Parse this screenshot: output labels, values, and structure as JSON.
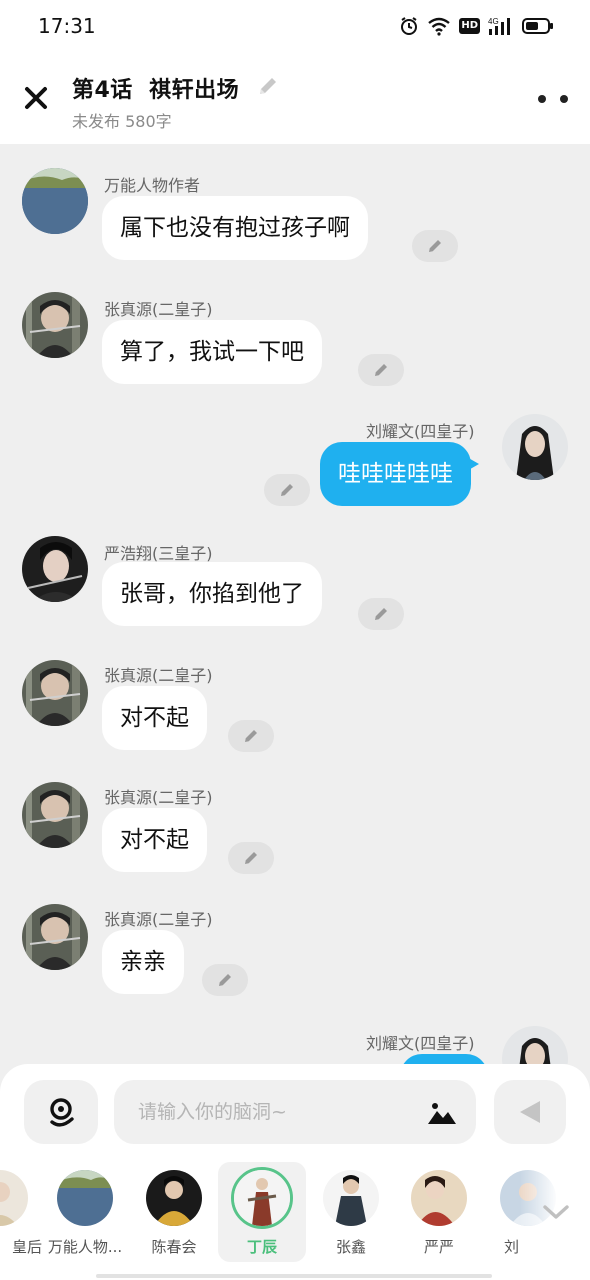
{
  "status": {
    "time": "17:31",
    "network": "4G",
    "hd": "HD"
  },
  "header": {
    "title": "第4话  祺轩出场",
    "subtitle": "未发布 580字"
  },
  "messages": [
    {
      "name": "万能人物作者",
      "text": "属下也没有抱过孩子啊",
      "side": "left"
    },
    {
      "name": "张真源(二皇子)",
      "text": "算了，我试一下吧",
      "side": "left"
    },
    {
      "name": "刘耀文(四皇子)",
      "text": "哇哇哇哇哇",
      "side": "right"
    },
    {
      "name": "严浩翔(三皇子)",
      "text": "张哥，你掐到他了",
      "side": "left"
    },
    {
      "name": "张真源(二皇子)",
      "text": "对不起",
      "side": "left"
    },
    {
      "name": "张真源(二皇子)",
      "text": "对不起",
      "side": "left"
    },
    {
      "name": "张真源(二皇子)",
      "text": "亲亲",
      "side": "left"
    },
    {
      "name": "刘耀文(四皇子)",
      "text": "",
      "side": "right"
    }
  ],
  "input": {
    "placeholder": "请输入你的脑洞~"
  },
  "characters": [
    {
      "label": "皇后",
      "color": "#e8e2d8"
    },
    {
      "label": "万能人物...",
      "color": "#4a6a8c"
    },
    {
      "label": "陈春会",
      "color": "#c8a040"
    },
    {
      "label": "丁辰",
      "color": "#7a4a3a",
      "selected": true
    },
    {
      "label": "张鑫",
      "color": "#3a4a58"
    },
    {
      "label": "严严",
      "color": "#b04838"
    },
    {
      "label": "刘",
      "color": "#b8c8d8"
    }
  ],
  "colors": {
    "accent_blue": "#1fb0ef",
    "selected_green": "#4bbf7c",
    "background": "#efefef"
  }
}
